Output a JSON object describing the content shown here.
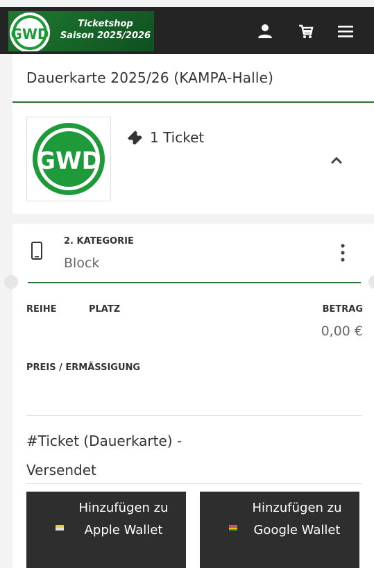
{
  "header": {
    "brand_line1": "Ticketshop",
    "brand_line2": "Saison 2025/2026",
    "logo_text": "GWD",
    "icons": [
      "user-icon",
      "cart-icon",
      "menu-icon"
    ],
    "bg_color": "#242424",
    "accent_color": "#1f7a30"
  },
  "page": {
    "title": "Dauerkarte 2025/26 (KAMPA-Halle)"
  },
  "summary": {
    "ticket_count": "1 Ticket",
    "logo_text": "GWD"
  },
  "ticket": {
    "category": "2. KATEGORIE",
    "block": "Block",
    "col_reihe": "REIHE",
    "col_platz": "PLATZ",
    "col_betrag": "BETRAG",
    "betrag_value": "0,00 €",
    "preis_label": "PREIS / ERMÄSSIGUNG",
    "status": "#Ticket (Dauerkarte) - Versendet"
  },
  "wallet": {
    "apple_label": "Hinzufügen zu Apple Wallet",
    "google_label": "Hinzufügen zu Google Wallet"
  }
}
